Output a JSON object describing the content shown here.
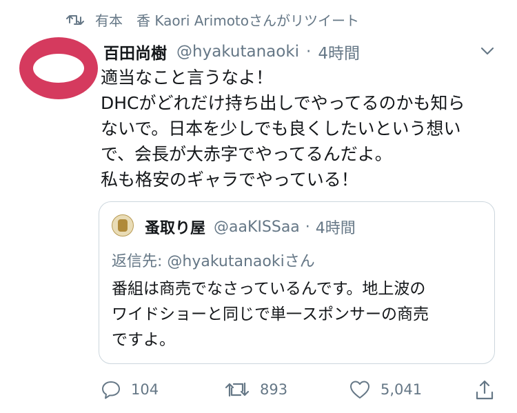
{
  "retweet": {
    "label": "有本　香  Kaori Arimotoさんがリツイート",
    "icon": "retweet-icon"
  },
  "tweet": {
    "display_name": "百田尚樹",
    "handle": "@hyakutanaoki",
    "separator": "·",
    "time": "4時間",
    "lines": [
      "適当なこと言うなよ！",
      "DHCがどれだけ持ち出しでやってるのかも知ら",
      "ないで。日本を少しでも良くしたいという想い",
      "で、会長が大赤字でやってるんだよ。",
      "私も格安のギャラでやっている！"
    ]
  },
  "quote": {
    "display_name": "蚤取り屋",
    "handle": "@aaKISSaa",
    "separator": "·",
    "time": "4時間",
    "reply_to": "返信先: @hyakutanaokiさん",
    "lines": [
      "番組は商売でなさっているんです。地上波の",
      "ワイドショーと同じで単一スポンサーの商売",
      "ですよ。"
    ]
  },
  "actions": {
    "replies": "104",
    "retweets": "893",
    "likes": "5,041"
  },
  "colors": {
    "text": "#14171a",
    "secondary": "#657786",
    "border": "#ccd6dd",
    "avatar": "#d53a5e"
  }
}
